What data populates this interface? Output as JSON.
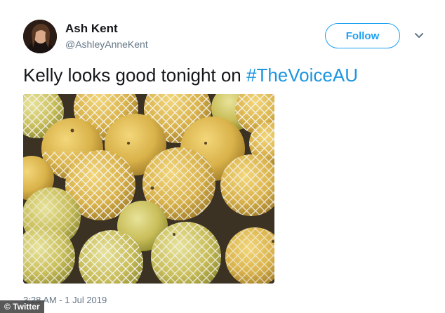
{
  "user": {
    "display_name": "Ash Kent",
    "handle": "@AshleyAnneKent",
    "avatar_icon": "profile-photo"
  },
  "actions": {
    "follow_label": "Follow",
    "menu_icon": "chevron-down-icon"
  },
  "tweet": {
    "text_prefix": "Kelly looks good tonight on ",
    "hashtag": "#TheVoiceAU",
    "image_icon": "photo-of-netted-pears",
    "timestamp": "3:28 AM - 1 Jul 2019"
  },
  "source_badge": "© Twitter",
  "colors": {
    "accent": "#1da1f2",
    "hashtag": "#1b95e0",
    "secondary_text": "#657786"
  }
}
